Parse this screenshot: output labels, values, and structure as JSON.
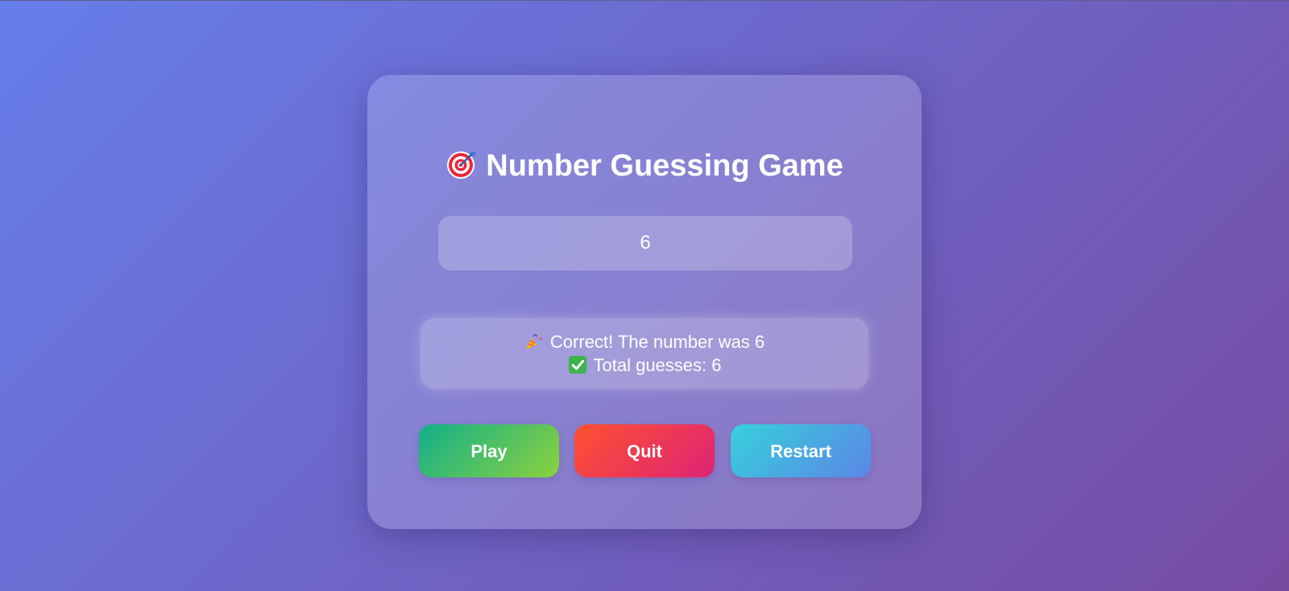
{
  "game": {
    "title_icon": "target-icon",
    "title": "Number Guessing Game",
    "guess_value": "6",
    "message": {
      "line1_icon": "party-popper-icon",
      "line1": "Correct! The number was 6",
      "line2_icon": "check-mark-icon",
      "line2": "Total guesses: 6"
    },
    "buttons": {
      "play": "Play",
      "quit": "Quit",
      "restart": "Restart"
    }
  },
  "colors": {
    "bg_start": "#667eea",
    "bg_end": "#764ba2",
    "play_start": "#11b08a",
    "play_end": "#8cd13e",
    "quit_start": "#ff512f",
    "quit_end": "#dd2476",
    "restart_start": "#36d1dc",
    "restart_end": "#5b86e5"
  }
}
